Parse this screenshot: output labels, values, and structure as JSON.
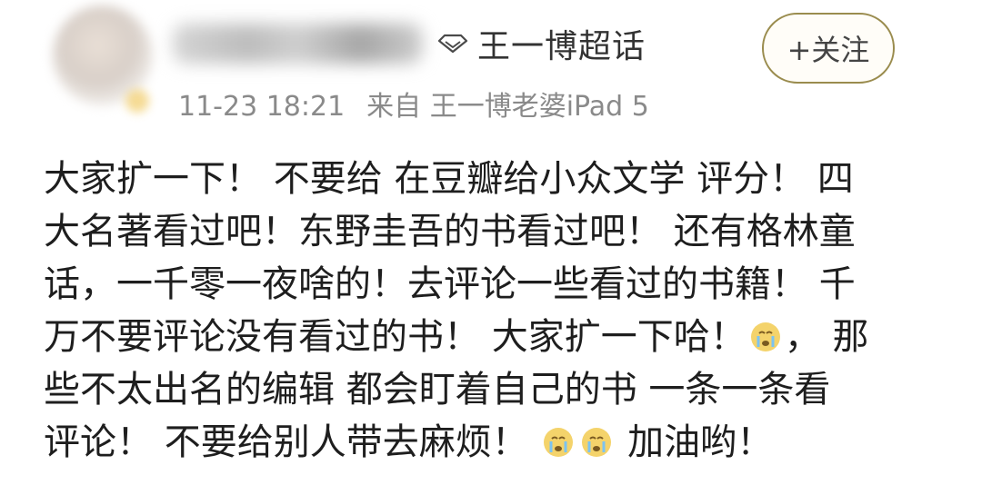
{
  "post": {
    "topic": "王一博超话",
    "follow_label": "+关注",
    "timestamp": "11-23 18:21",
    "source": "来自 王一博老婆iPad 5",
    "content": {
      "line1": "大家扩一下！ 不要给 在豆瓣给小众文学 评分！ 四",
      "line2": "大名著看过吧！东野圭吾的书看过吧！ 还有格林童",
      "line3": "话，一千零一夜啥的！去评论一些看过的书籍！ 千",
      "line4a": "万不要评论没有看过的书！ 大家扩一下哈！",
      "line4b": "， 那",
      "line5": "些不太出名的编辑 都会盯着自己的书 一条一条看",
      "line6a": "评论！ 不要给别人带去麻烦！",
      "line6b": "加油哟！"
    },
    "icons": {
      "topic": "diamond-icon",
      "emoji": "crying-face-emoji",
      "avatar": "blurred-avatar"
    },
    "colors": {
      "follow_border": "#9a8c4e",
      "meta_text": "#8a8a8a",
      "emoji": "#f4d36b"
    }
  }
}
